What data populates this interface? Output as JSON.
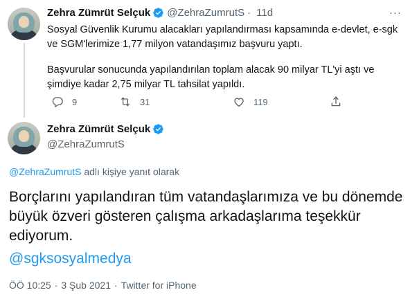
{
  "first_tweet": {
    "author_name": "Zehra Zümrüt Selçuk",
    "handle": "@ZehraZumrutS",
    "separator": "·",
    "age": "11d",
    "more_label": "···",
    "paragraph_1": "Sosyal Güvenlik Kurumu alacakları yapılandırması kapsamında e-devlet, e-sgk ve SGM'lerimize 1,77 milyon vatandaşımız başvuru yaptı.",
    "paragraph_2": "Başvurular sonucunda yapılandırılan toplam alacak 90 milyar TL'yi aştı ve şimdiye kadar 2,75 milyar TL tahsilat yapıldı.",
    "reply_count": "9",
    "retweet_count": "31",
    "like_count": "119"
  },
  "main_tweet": {
    "author_name": "Zehra Zümrüt Selçuk",
    "handle": "@ZehraZumrutS",
    "reply_mention": "@ZehraZumrutS",
    "reply_suffix": " adlı kişiye yanıt olarak",
    "text": "Borçlarını yapılandıran tüm vatandaşlarımıza ve bu dönemde büyük özveri gösteren çalışma arkadaşlarıma teşekkür ediyorum.",
    "mention_link": "@sgksosyalmedya",
    "time": "ÖÖ 10:25",
    "date": "3 Şub 2021",
    "source": "Twitter for iPhone",
    "meta_separator": "·"
  },
  "icons": {
    "verified": "verified-badge-icon",
    "reply": "reply-icon",
    "retweet": "retweet-icon",
    "like": "heart-icon",
    "share": "share-icon"
  },
  "colors": {
    "accent": "#1d9bf0",
    "secondary_text": "#536471",
    "primary_text": "#0f1419",
    "thread_line": "#cfd9de"
  }
}
